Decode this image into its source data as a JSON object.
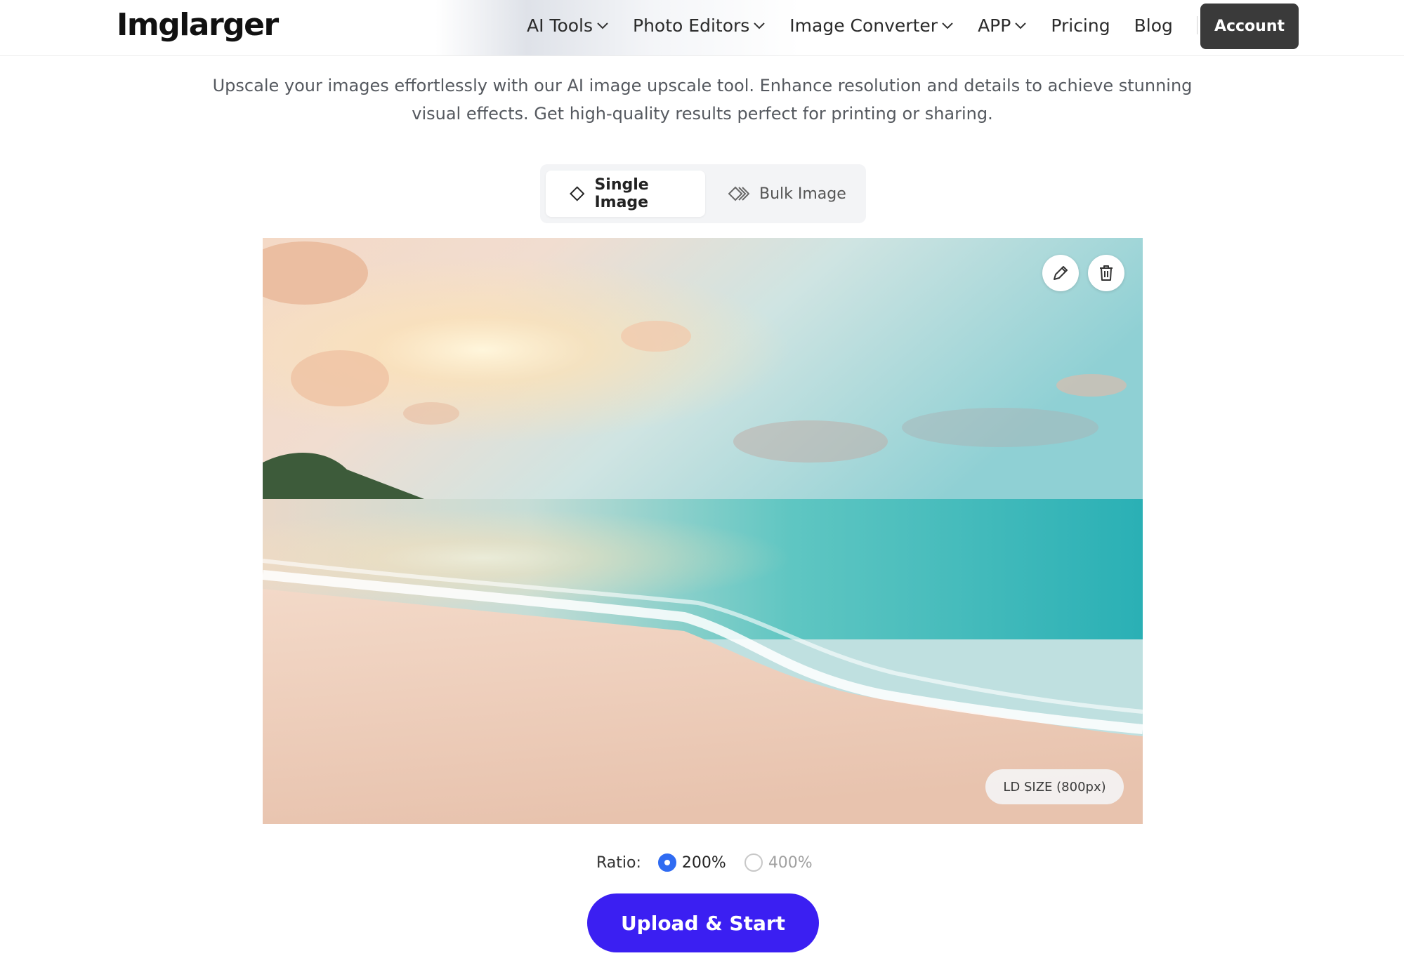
{
  "header": {
    "logo_text": "Imglarger",
    "nav": [
      {
        "label": "AI Tools",
        "has_dropdown": true
      },
      {
        "label": "Photo Editors",
        "has_dropdown": true
      },
      {
        "label": "Image Converter",
        "has_dropdown": true
      },
      {
        "label": "APP",
        "has_dropdown": true
      },
      {
        "label": "Pricing",
        "has_dropdown": false
      },
      {
        "label": "Blog",
        "has_dropdown": false
      }
    ],
    "account_label": "Account"
  },
  "description": "Upscale your images effortlessly with our AI image upscale tool. Enhance resolution and details to achieve stunning visual effects. Get high-quality results perfect for printing or sharing.",
  "mode_toggle": {
    "single_label": "Single Image",
    "bulk_label": "Bulk Image",
    "selected": "Single Image"
  },
  "preview": {
    "icons": [
      "edit-icon",
      "trash-icon"
    ],
    "size_badge": "LD SIZE (800px)"
  },
  "ratio": {
    "label": "Ratio:",
    "options": [
      {
        "label": "200%",
        "selected": true
      },
      {
        "label": "400%",
        "selected": false
      }
    ]
  },
  "upload_button": "Upload & Start",
  "colors": {
    "accent": "#3b1ff2",
    "radio_selected": "#2f6bf2",
    "account_bg": "#3a3a3a"
  }
}
